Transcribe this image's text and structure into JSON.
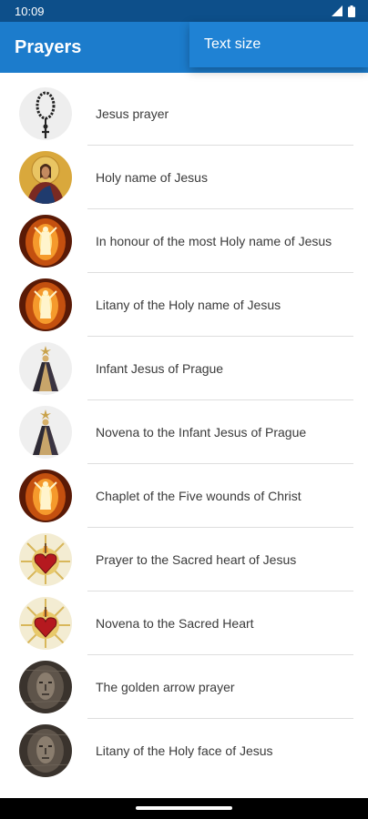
{
  "status": {
    "time": "10:09"
  },
  "appbar": {
    "title": "Prayers"
  },
  "menu": {
    "items": [
      "Text size"
    ]
  },
  "prayers": [
    {
      "label": "Jesus prayer",
      "icon": "prayer-rope-icon"
    },
    {
      "label": "Holy name of Jesus",
      "icon": "christ-icon-image"
    },
    {
      "label": "In honour of the most Holy name of Jesus",
      "icon": "risen-christ-image"
    },
    {
      "label": "Litany of the Holy name of Jesus",
      "icon": "risen-christ-image"
    },
    {
      "label": "Infant Jesus of Prague",
      "icon": "infant-jesus-image"
    },
    {
      "label": "Novena to the Infant Jesus of Prague",
      "icon": "infant-jesus-image"
    },
    {
      "label": "Chaplet of the Five wounds of Christ",
      "icon": "risen-christ-image"
    },
    {
      "label": "Prayer to the Sacred heart of Jesus",
      "icon": "sacred-heart-image"
    },
    {
      "label": "Novena to the Sacred Heart",
      "icon": "sacred-heart-image"
    },
    {
      "label": "The golden arrow prayer",
      "icon": "holy-face-image"
    },
    {
      "label": "Litany of the Holy face of Jesus",
      "icon": "holy-face-image"
    }
  ],
  "colors": {
    "statusbar": "#0d4f8a",
    "appbar": "#1c7ccc",
    "menu": "#1f82d4",
    "divider": "#dedede"
  }
}
